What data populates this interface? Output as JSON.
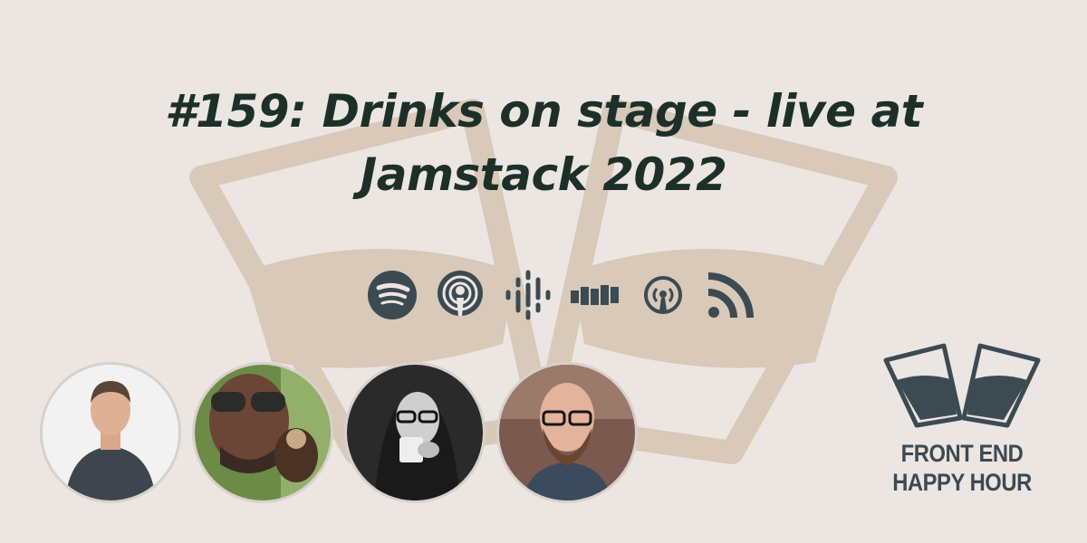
{
  "episode": {
    "title_line1": "#159: Drinks on stage - live at",
    "title_line2": "Jamstack 2022"
  },
  "platforms": [
    {
      "icon": "spotify-icon",
      "name": "Spotify"
    },
    {
      "icon": "apple-podcasts-icon",
      "name": "Apple Podcasts"
    },
    {
      "icon": "google-podcasts-icon",
      "name": "Google Podcasts"
    },
    {
      "icon": "stitcher-icon",
      "name": "Stitcher"
    },
    {
      "icon": "overcast-icon",
      "name": "Overcast"
    },
    {
      "icon": "rss-icon",
      "name": "RSS"
    }
  ],
  "hosts": [
    {
      "icon": "host-avatar-1"
    },
    {
      "icon": "host-avatar-2"
    },
    {
      "icon": "host-avatar-3"
    },
    {
      "icon": "host-avatar-4"
    }
  ],
  "brand": {
    "line1": "FRONT END",
    "line2": "HAPPY HOUR"
  },
  "colors": {
    "background": "#ebe6e2",
    "title": "#1c3029",
    "icons": "#3c4a52",
    "watermark": "#d8c9b8"
  }
}
